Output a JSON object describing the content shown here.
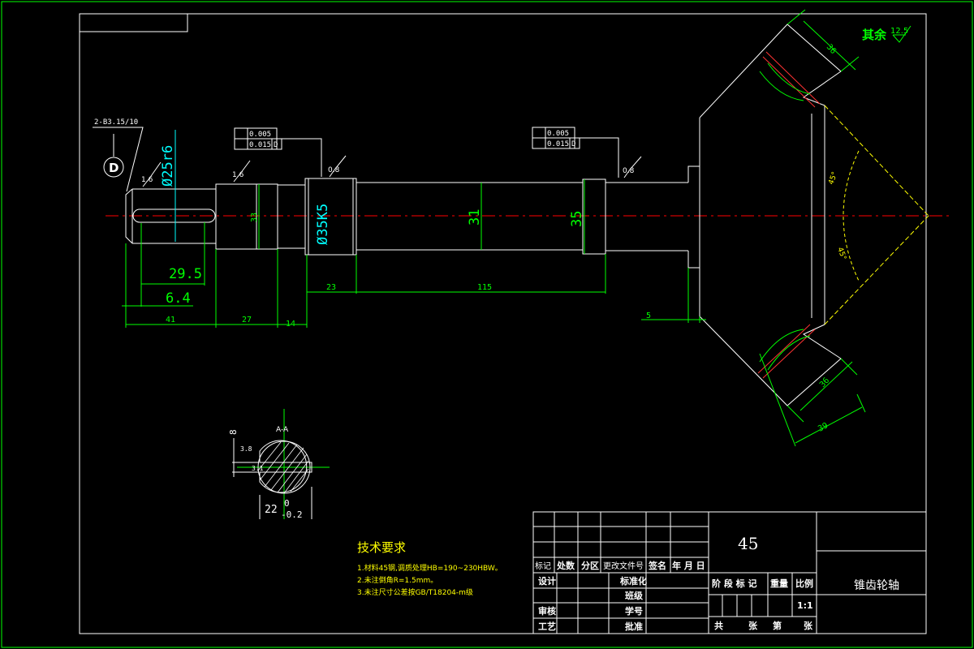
{
  "colors": {
    "background": "#000000",
    "frame": "#00ff00",
    "outline": "#ffffff",
    "dimension": "#00ff00",
    "centerline": "#ff0000",
    "tolerance_text": "#ffffff",
    "annotation_cyan": "#00ffff",
    "notes": "#ffff00"
  },
  "surface_finish": {
    "other_label": "其余",
    "other_value": "12.5",
    "marks": [
      "1.6",
      "1.6",
      "0.8",
      "0.8",
      "3.2"
    ]
  },
  "center_hole": {
    "label": "2-B3.15/10",
    "datum": "D"
  },
  "tolerances": [
    {
      "runout": "0.005",
      "flatness": "0.015",
      "datum": "D"
    },
    {
      "runout": "0.005",
      "flatness": "0.015",
      "datum": "D"
    }
  ],
  "dimensions": {
    "dia_25": "Ø25r6",
    "dia_33": "33",
    "dia_35k5": "Ø35K5",
    "dia_31": "31",
    "dia_35": "35",
    "len_29_5": "29.5",
    "len_6_4": "6.4",
    "len_41": "41",
    "len_27": "27",
    "len_14": "14",
    "len_23": "23",
    "len_115": "115",
    "len_5": "5",
    "gear_top": "36",
    "gear_bottom": "36",
    "gear_width": "39",
    "angle_top": "45°",
    "angle_bottom": "45°"
  },
  "section": {
    "title": "A-A",
    "width": "8",
    "keyway_top": "3.8",
    "keyway_side": "3.1",
    "depth_value": "22",
    "depth_tol_upper": "0",
    "depth_tol_lower": "-0.2"
  },
  "tech_requirements": {
    "title": "技术要求",
    "items": [
      "1.材料45钢,调质处理HB=190~230HBW。",
      "2.未注倒角R=1.5mm。",
      "3.未注尺寸公差按GB/T18204-m级"
    ]
  },
  "title_block": {
    "material": "45",
    "part_name": "锥齿轮轴",
    "row_headers": [
      "标记",
      "处数",
      "分区",
      "更改文件号",
      "签名",
      "年 月 日"
    ],
    "roles_left": [
      "设计",
      "审核",
      "工艺"
    ],
    "roles_right": [
      "标准化",
      "班级",
      "学号",
      "批准"
    ],
    "stage_headers": [
      "阶 段 标 记",
      "重量",
      "比例"
    ],
    "scale": "1:1",
    "sheet_info": [
      "共",
      "张",
      "第",
      "张"
    ]
  }
}
